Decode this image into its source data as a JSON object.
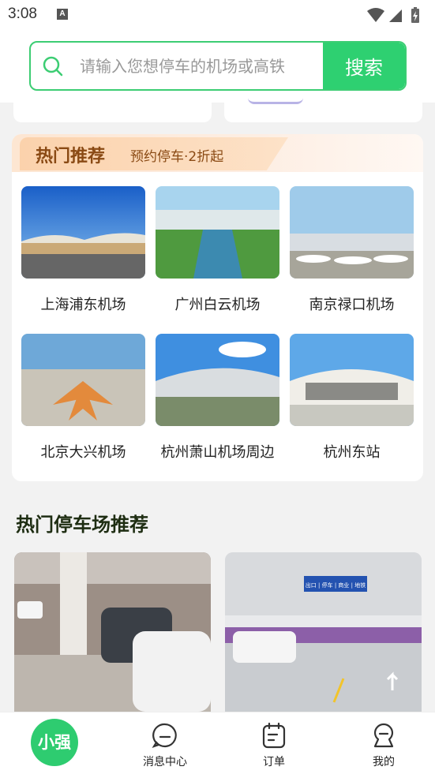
{
  "status": {
    "time": "3:08",
    "notif_icon": "A"
  },
  "search": {
    "placeholder": "请输入您想停车的机场或高铁",
    "button_label": "搜索",
    "accent": "#2ed071"
  },
  "hot": {
    "title": "热门推荐",
    "subtitle": "预约停车·2折起",
    "spots": [
      {
        "label": "上海浦东机场"
      },
      {
        "label": "广州白云机场"
      },
      {
        "label": "南京禄口机场"
      },
      {
        "label": "北京大兴机场"
      },
      {
        "label": "杭州萧山机场周边"
      },
      {
        "label": "杭州东站"
      }
    ]
  },
  "parking": {
    "title": "热门停车场推荐",
    "sign_text": "出口 | 停车 | 商业 | 地铁"
  },
  "tabbar": {
    "home_label": "小强",
    "messages_label": "消息中心",
    "orders_label": "订单",
    "mine_label": "我的"
  }
}
